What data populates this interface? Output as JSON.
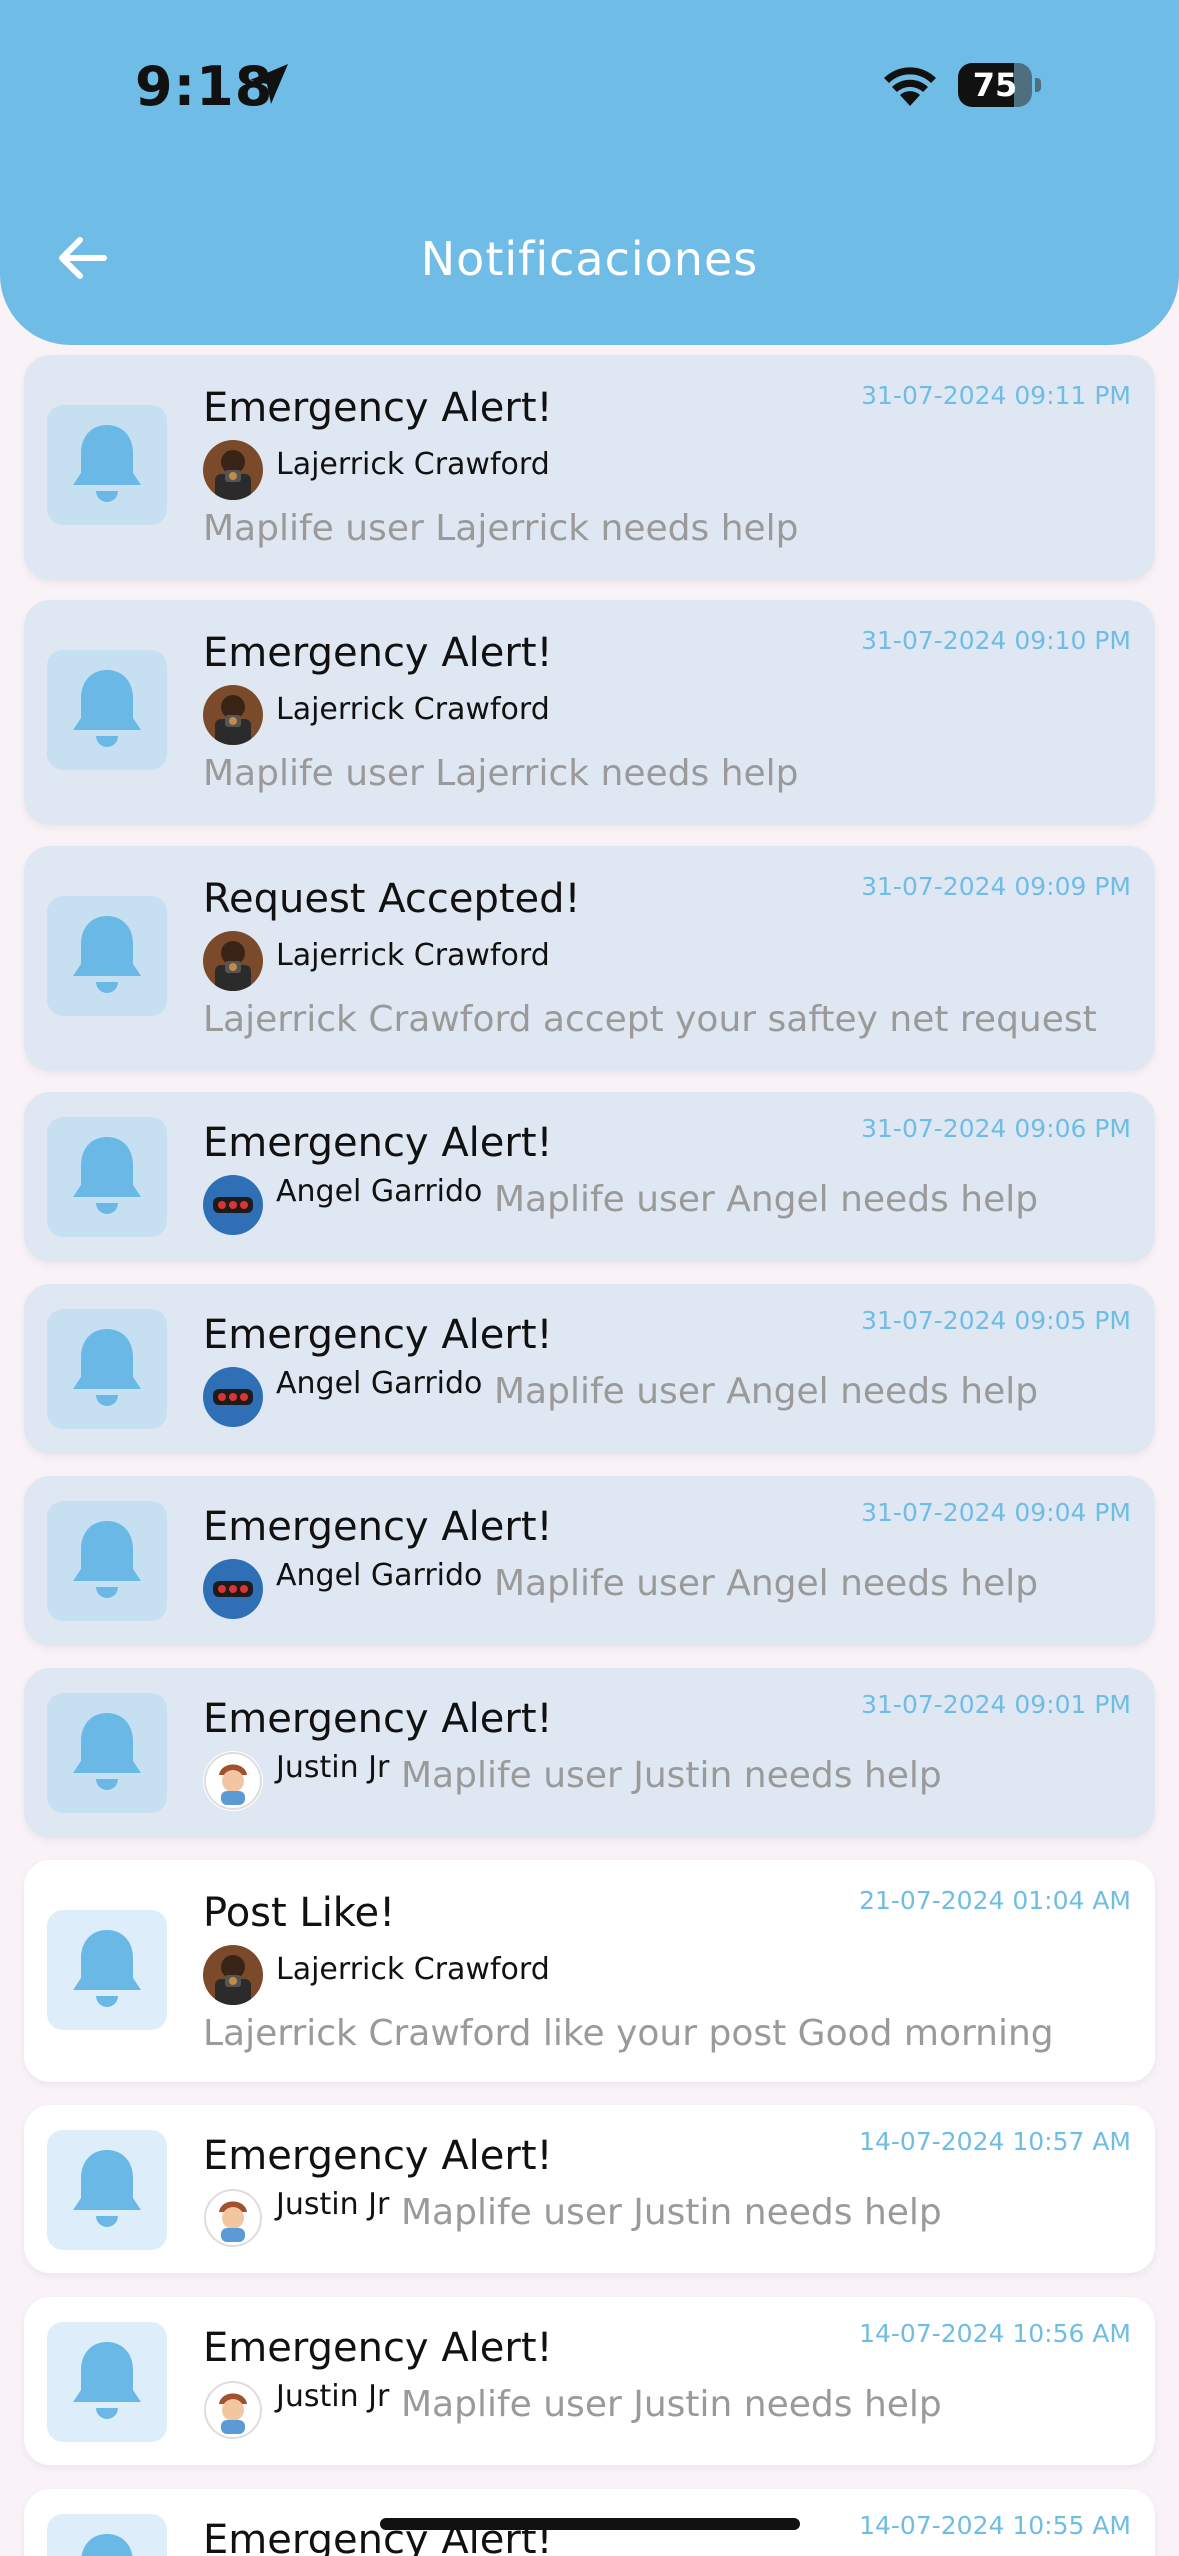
{
  "status_bar": {
    "time": "9:18",
    "battery": "75",
    "battery_level": 0.75
  },
  "header": {
    "title": "Notificaciones"
  },
  "notifications": [
    {
      "title": "Emergency Alert!",
      "date": "31-07-2024 09:11 PM",
      "user": "Lajerrick Crawford",
      "message": "Maplife user Lajerrick needs help",
      "avatar": "portrait-avatar",
      "read": false
    },
    {
      "title": "Emergency Alert!",
      "date": "31-07-2024 09:10 PM",
      "user": "Lajerrick Crawford",
      "message": "Maplife user Lajerrick needs help",
      "avatar": "portrait-avatar",
      "read": false
    },
    {
      "title": "Request Accepted!",
      "date": "31-07-2024 09:09 PM",
      "user": "Lajerrick Crawford",
      "message": "Lajerrick Crawford accept your saftey net request",
      "avatar": "portrait-avatar",
      "read": false
    },
    {
      "title": "Emergency Alert!",
      "date": "31-07-2024 09:06 PM",
      "user": "Angel Garrido",
      "message": "Maplife user Angel needs help",
      "avatar": "traffic-light-avatar",
      "read": false
    },
    {
      "title": "Emergency Alert!",
      "date": "31-07-2024 09:05 PM",
      "user": "Angel Garrido",
      "message": "Maplife user Angel needs help",
      "avatar": "traffic-light-avatar",
      "read": false
    },
    {
      "title": "Emergency Alert!",
      "date": "31-07-2024 09:04 PM",
      "user": "Angel Garrido",
      "message": "Maplife user Angel needs help",
      "avatar": "traffic-light-avatar",
      "read": false
    },
    {
      "title": "Emergency Alert!",
      "date": "31-07-2024 09:01 PM",
      "user": "Justin Jr",
      "message": "Maplife user Justin needs help",
      "avatar": "cartoon-avatar",
      "read": false
    },
    {
      "title": "Post Like!",
      "date": "21-07-2024 01:04 AM",
      "user": "Lajerrick Crawford",
      "message": "Lajerrick Crawford like your post Good morning",
      "avatar": "portrait-avatar",
      "read": true
    },
    {
      "title": "Emergency Alert!",
      "date": "14-07-2024 10:57 AM",
      "user": "Justin Jr",
      "message": "Maplife user Justin needs help",
      "avatar": "cartoon-avatar",
      "read": true
    },
    {
      "title": "Emergency Alert!",
      "date": "14-07-2024 10:56 AM",
      "user": "Justin Jr",
      "message": "Maplife user Justin needs help",
      "avatar": "cartoon-avatar",
      "read": true
    },
    {
      "title": "Emergency Alert!",
      "date": "14-07-2024 10:55 AM",
      "user": "",
      "message": "",
      "avatar": "",
      "read": true
    }
  ],
  "colors": {
    "header": "#6fbde6",
    "unread_card": "#dfe8f2",
    "read_card": "#ffffff",
    "accent": "#6fbde6",
    "bell": "#6ab8e6"
  }
}
